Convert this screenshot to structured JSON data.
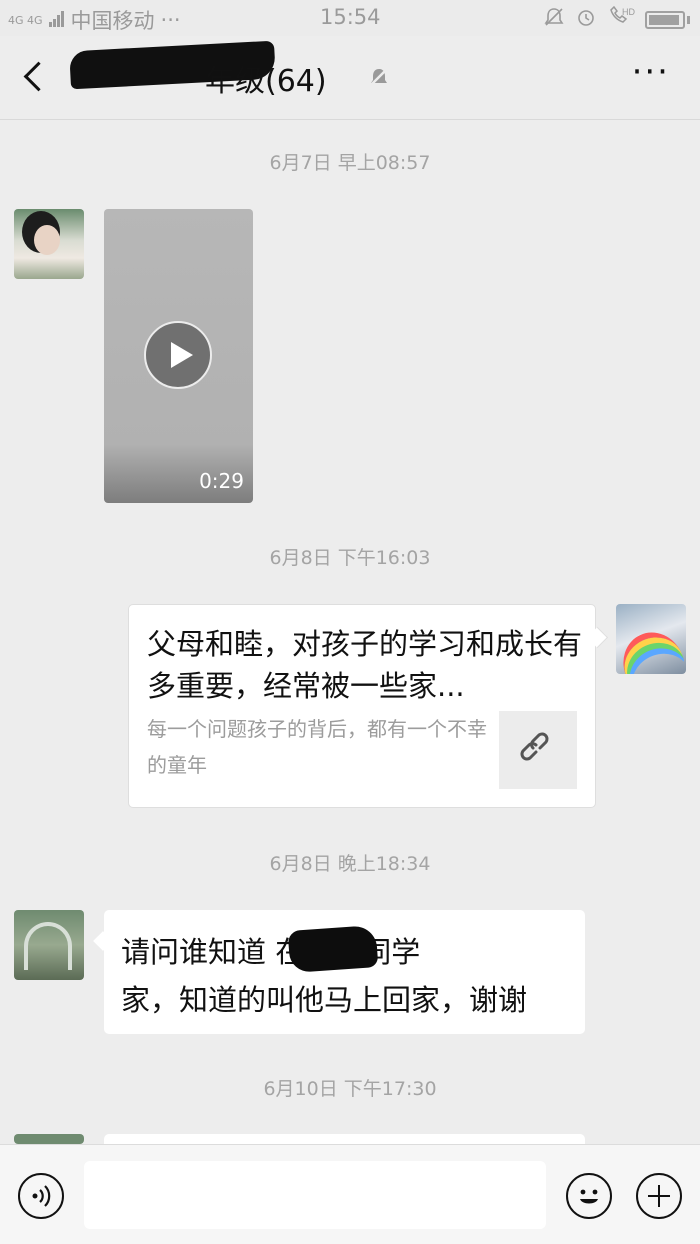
{
  "status_bar": {
    "network": "4G 4G",
    "carrier": "中国移动",
    "carrier_more": "···",
    "time": "15:54",
    "hd_label": "HD"
  },
  "header": {
    "title_visible": "年级(64)",
    "more_label": "···"
  },
  "messages": {
    "ts1": "6月7日 早上08:57",
    "video_duration": "0:29",
    "ts2": "6月8日 下午16:03",
    "link_title": "父母和睦，对孩子的学习和成长有多重要，经常被一些家...",
    "link_desc": "每一个问题孩子的背后，都有一个不幸的童年",
    "ts3": "6月8日 晚上18:34",
    "text_line1": "请问谁知道        在哪位同学",
    "text_line2": "家，知道的叫他马上回家，谢谢",
    "ts4": "6月10日 下午17:30"
  },
  "input_bar": {
    "placeholder": ""
  },
  "icons": {
    "back": "chevron-left-icon",
    "mute": "bell-off-icon",
    "voice": "voice-icon",
    "emoji": "emoji-icon",
    "plus": "plus-icon",
    "link": "link-icon"
  }
}
